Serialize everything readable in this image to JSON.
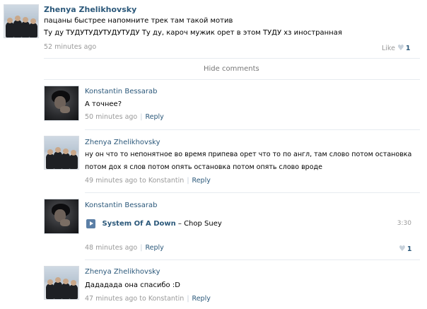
{
  "post": {
    "author": "Zhenya Zhelikhovsky",
    "lines": [
      "пацаны быстрее напомните трек там такой мотив",
      "Ту ду ТУДУТУДУТУДУТУДУ Ту ду, кароч мужик орет в этом ТУДУ хз иностранная"
    ],
    "time": "52 minutes ago",
    "like_label": "Like",
    "like_count": "1",
    "heart_icon": "heart-icon"
  },
  "hide_comments": "Hide comments",
  "comments": [
    {
      "author": "Konstantin Bessarab",
      "text": "А точнее?",
      "time": "50 minutes ago",
      "reply": "Reply"
    },
    {
      "author": "Zhenya Zhelikhovsky",
      "lines": [
        "ну он что то непонятное во время припева орет что то по англ, там слово потом остановка",
        "потом дох  я слов потом опять остановка потом опять слово вроде"
      ],
      "time": "49 minutes ago to Konstantin",
      "reply": "Reply"
    },
    {
      "author": "Konstantin Bessarab",
      "track": {
        "artist": "System Of A Down",
        "dash": " – ",
        "title": "Chop Suey",
        "duration": "3:30",
        "icon": "play-icon"
      },
      "time": "48 minutes ago",
      "reply": "Reply",
      "like_count": "1"
    },
    {
      "author": "Zhenya Zhelikhovsky",
      "text": "Дададада она спасибо :D",
      "time": "47 minutes ago to Konstantin",
      "reply": "Reply"
    }
  ],
  "colors": {
    "link": "#2b587a",
    "meta": "#999999",
    "play_button": "#5b7fa6"
  }
}
